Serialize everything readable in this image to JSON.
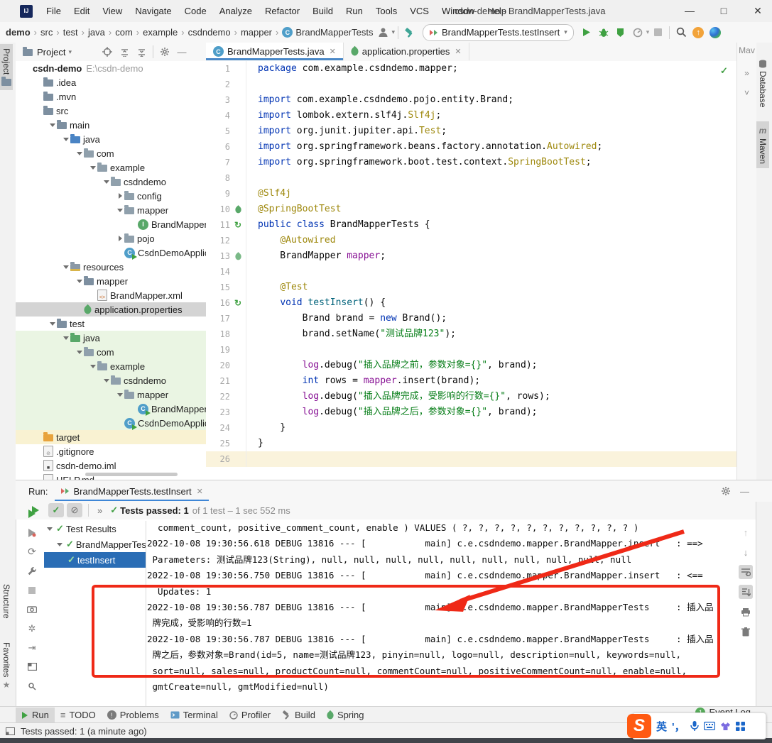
{
  "window": {
    "title": "csdn-demo - BrandMapperTests.java",
    "menus": [
      "File",
      "Edit",
      "View",
      "Navigate",
      "Code",
      "Analyze",
      "Refactor",
      "Build",
      "Run",
      "Tools",
      "VCS",
      "Window",
      "Help"
    ],
    "controls": {
      "minimize": "—",
      "maximize": "□",
      "close": "✕"
    }
  },
  "navbar": {
    "breadcrumbs": [
      "demo",
      "src",
      "test",
      "java",
      "com",
      "example",
      "csdndemo",
      "mapper",
      "BrandMapperTests"
    ],
    "run_config": "BrandMapperTests.testInsert"
  },
  "left_stripe": {
    "top": [
      "Project"
    ],
    "bottom": [
      "Structure",
      "Favorites"
    ]
  },
  "right_stripe": [
    "Database",
    "Maven"
  ],
  "maven_strip": {
    "title": "Mav",
    "more": "»",
    "collapse": "˅"
  },
  "project_panel": {
    "header": "Project",
    "tree": [
      {
        "label": "csdn-demo",
        "extra": "E:\\csdn-demo",
        "level": 0,
        "icon": "",
        "chev": "",
        "bold": true
      },
      {
        "label": ".idea",
        "level": 1,
        "icon": "folder",
        "chev": ""
      },
      {
        "label": ".mvn",
        "level": 1,
        "icon": "folder",
        "chev": ""
      },
      {
        "label": "src",
        "level": 1,
        "icon": "folder",
        "chev": ""
      },
      {
        "label": "main",
        "level": 2,
        "icon": "folder",
        "chev": "v"
      },
      {
        "label": "java",
        "level": 3,
        "icon": "folder-blue",
        "chev": "v"
      },
      {
        "label": "com",
        "level": 4,
        "icon": "package",
        "chev": "v"
      },
      {
        "label": "example",
        "level": 5,
        "icon": "package",
        "chev": "v"
      },
      {
        "label": "csdndemo",
        "level": 6,
        "icon": "package",
        "chev": "v"
      },
      {
        "label": "config",
        "level": 7,
        "icon": "package",
        "chev": ">"
      },
      {
        "label": "mapper",
        "level": 7,
        "icon": "package",
        "chev": "v"
      },
      {
        "label": "BrandMapper",
        "level": 8,
        "icon": "interface",
        "chev": ""
      },
      {
        "label": "pojo",
        "level": 7,
        "icon": "package",
        "chev": ">"
      },
      {
        "label": "CsdnDemoApplication",
        "level": 7,
        "icon": "class-run",
        "chev": ""
      },
      {
        "label": "resources",
        "level": 3,
        "icon": "folder-res",
        "chev": "v"
      },
      {
        "label": "mapper",
        "level": 4,
        "icon": "folder",
        "chev": "v"
      },
      {
        "label": "BrandMapper.xml",
        "level": 5,
        "icon": "xml",
        "chev": ""
      },
      {
        "label": "application.properties",
        "level": 4,
        "icon": "spring-file",
        "chev": "",
        "bg": "selected"
      },
      {
        "label": "test",
        "level": 2,
        "icon": "folder",
        "chev": "v"
      },
      {
        "label": "java",
        "level": 3,
        "icon": "folder-green",
        "chev": "v",
        "bg": "test"
      },
      {
        "label": "com",
        "level": 4,
        "icon": "package",
        "chev": "v",
        "bg": "test"
      },
      {
        "label": "example",
        "level": 5,
        "icon": "package",
        "chev": "v",
        "bg": "test"
      },
      {
        "label": "csdndemo",
        "level": 6,
        "icon": "package",
        "chev": "v",
        "bg": "test"
      },
      {
        "label": "mapper",
        "level": 7,
        "icon": "package",
        "chev": "v",
        "bg": "test"
      },
      {
        "label": "BrandMapperTests",
        "level": 8,
        "icon": "class-test",
        "chev": "",
        "bg": "test"
      },
      {
        "label": "CsdnDemoApplicationTests",
        "level": 7,
        "icon": "class-test",
        "chev": "",
        "bg": "test"
      },
      {
        "label": "target",
        "level": 1,
        "icon": "folder-excluded",
        "chev": "",
        "bg": "excluded"
      },
      {
        "label": ".gitignore",
        "level": 1,
        "icon": "ignore-file",
        "chev": ""
      },
      {
        "label": "csdn-demo.iml",
        "level": 1,
        "icon": "iml-file",
        "chev": ""
      },
      {
        "label": "HELP.md",
        "level": 1,
        "icon": "file",
        "chev": ""
      }
    ]
  },
  "editor": {
    "tabs": [
      {
        "label": "BrandMapperTests.java",
        "icon": "class",
        "active": true
      },
      {
        "label": "application.properties",
        "icon": "spring-file",
        "active": false
      }
    ],
    "lines": [
      {
        "n": 1,
        "t": [
          [
            "k",
            "package "
          ],
          [
            "p",
            "com.example.csdndemo.mapper;"
          ]
        ]
      },
      {
        "n": 2,
        "t": []
      },
      {
        "n": 3,
        "t": [
          [
            "k",
            "import "
          ],
          [
            "p",
            "com.example.csdndemo.pojo.entity.Brand;"
          ]
        ]
      },
      {
        "n": 4,
        "t": [
          [
            "k",
            "import "
          ],
          [
            "p",
            "lombok.extern.slf4j."
          ],
          [
            "a",
            "Slf4j"
          ],
          [
            "p",
            ";"
          ]
        ]
      },
      {
        "n": 5,
        "t": [
          [
            "k",
            "import "
          ],
          [
            "p",
            "org.junit.jupiter.api."
          ],
          [
            "a",
            "Test"
          ],
          [
            "p",
            ";"
          ]
        ]
      },
      {
        "n": 6,
        "t": [
          [
            "k",
            "import "
          ],
          [
            "p",
            "org.springframework.beans.factory.annotation."
          ],
          [
            "a",
            "Autowired"
          ],
          [
            "p",
            ";"
          ]
        ]
      },
      {
        "n": 7,
        "t": [
          [
            "k",
            "import "
          ],
          [
            "p",
            "org.springframework.boot.test.context."
          ],
          [
            "a",
            "SpringBootTest"
          ],
          [
            "p",
            ";"
          ]
        ]
      },
      {
        "n": 8,
        "t": []
      },
      {
        "n": 9,
        "t": [
          [
            "a",
            "@Slf4j"
          ]
        ]
      },
      {
        "n": 10,
        "icon": "leaf",
        "t": [
          [
            "a",
            "@SpringBootTest"
          ]
        ]
      },
      {
        "n": 11,
        "icon": "run",
        "t": [
          [
            "k",
            "public class "
          ],
          [
            "p",
            "BrandMapperTests {"
          ]
        ]
      },
      {
        "n": 12,
        "t": [
          [
            "p",
            "    "
          ],
          [
            "a",
            "@Autowired"
          ]
        ]
      },
      {
        "n": 13,
        "icon": "bean",
        "t": [
          [
            "p",
            "    BrandMapper "
          ],
          [
            "f",
            "mapper"
          ],
          [
            "p",
            ";"
          ]
        ]
      },
      {
        "n": 14,
        "t": []
      },
      {
        "n": 15,
        "t": [
          [
            "p",
            "    "
          ],
          [
            "a",
            "@Test"
          ]
        ]
      },
      {
        "n": 16,
        "icon": "run",
        "t": [
          [
            "p",
            "    "
          ],
          [
            "k",
            "void "
          ],
          [
            "m",
            "testInsert"
          ],
          [
            "p",
            "() {"
          ]
        ]
      },
      {
        "n": 17,
        "t": [
          [
            "p",
            "        Brand brand = "
          ],
          [
            "k",
            "new"
          ],
          [
            "p",
            " Brand();"
          ]
        ]
      },
      {
        "n": 18,
        "t": [
          [
            "p",
            "        brand.setName("
          ],
          [
            "s",
            "\"测试品牌123\""
          ],
          [
            "p",
            ");"
          ]
        ]
      },
      {
        "n": 19,
        "t": []
      },
      {
        "n": 20,
        "t": [
          [
            "p",
            "        "
          ],
          [
            "f",
            "log"
          ],
          [
            "p",
            ".debug("
          ],
          [
            "s",
            "\"插入品牌之前，参数对象={}\""
          ],
          [
            "p",
            ", brand);"
          ]
        ]
      },
      {
        "n": 21,
        "t": [
          [
            "p",
            "        "
          ],
          [
            "k",
            "int"
          ],
          [
            "p",
            " rows = "
          ],
          [
            "f",
            "mapper"
          ],
          [
            "p",
            ".insert(brand);"
          ]
        ]
      },
      {
        "n": 22,
        "t": [
          [
            "p",
            "        "
          ],
          [
            "f",
            "log"
          ],
          [
            "p",
            ".debug("
          ],
          [
            "s",
            "\"插入品牌完成，受影响的行数={}\""
          ],
          [
            "p",
            ", rows);"
          ]
        ]
      },
      {
        "n": 23,
        "t": [
          [
            "p",
            "        "
          ],
          [
            "f",
            "log"
          ],
          [
            "p",
            ".debug("
          ],
          [
            "s",
            "\"插入品牌之后，参数对象={}\""
          ],
          [
            "p",
            ", brand);"
          ]
        ]
      },
      {
        "n": 24,
        "t": [
          [
            "p",
            "    }"
          ]
        ]
      },
      {
        "n": 25,
        "t": [
          [
            "p",
            "}"
          ]
        ]
      },
      {
        "n": 26,
        "caret": true,
        "t": []
      }
    ]
  },
  "run_panel": {
    "label": "Run:",
    "tab": "BrandMapperTests.testInsert",
    "result_bold": "Tests passed: 1",
    "result_gray": "of 1 test – 1 sec 552 ms",
    "test_tree": [
      {
        "label": "Test Results",
        "chev": "v"
      },
      {
        "label": "BrandMapperTests",
        "chev": "v",
        "indent": 1
      },
      {
        "label": "testInsert",
        "indent": 2,
        "selected": true
      }
    ],
    "console_lines": [
      "  comment_count, positive_comment_count, enable ) VALUES ( ?, ?, ?, ?, ?, ?, ?, ?, ?, ?, ? )",
      "2022-10-08 19:30:56.618 DEBUG 13816 --- [           main] c.e.csdndemo.mapper.BrandMapper.insert   : ==>",
      " Parameters: 测试品牌123(String), null, null, null, null, null, null, null, null, null, null",
      "2022-10-08 19:30:56.750 DEBUG 13816 --- [           main] c.e.csdndemo.mapper.BrandMapper.insert   : <==",
      "  Updates: 1",
      "2022-10-08 19:30:56.787 DEBUG 13816 --- [           main] c.e.csdndemo.mapper.BrandMapperTests     : 插入品",
      " 牌完成，受影响的行数=1",
      "2022-10-08 19:30:56.787 DEBUG 13816 --- [           main] c.e.csdndemo.mapper.BrandMapperTests     : 插入品",
      " 牌之后，参数对象=Brand(id=5, name=测试品牌123, pinyin=null, logo=null, description=null, keywords=null,",
      " sort=null, sales=null, productCount=null, commentCount=null, positiveCommentCount=null, enable=null,",
      " gmtCreate=null, gmtModified=null)"
    ]
  },
  "bottom_bar": {
    "items": [
      {
        "icon": "run",
        "label": "Run",
        "active": true
      },
      {
        "icon": "todo",
        "label": "TODO"
      },
      {
        "icon": "problems",
        "label": "Problems"
      },
      {
        "icon": "terminal",
        "label": "Terminal"
      },
      {
        "icon": "profiler",
        "label": "Profiler"
      },
      {
        "icon": "build",
        "label": "Build"
      },
      {
        "icon": "spring",
        "label": "Spring"
      }
    ],
    "event_log": {
      "badge": "1",
      "label": "Event Log"
    }
  },
  "status_bar": {
    "text": "Tests passed: 1 (a minute ago)"
  },
  "ime": {
    "lang": "英",
    "punct": "'，"
  },
  "colors": {
    "annotation_red": "#ef2917",
    "selection_blue": "#2a6db5",
    "test_green": "#44a046",
    "accent_blue": "#4a88c7"
  }
}
